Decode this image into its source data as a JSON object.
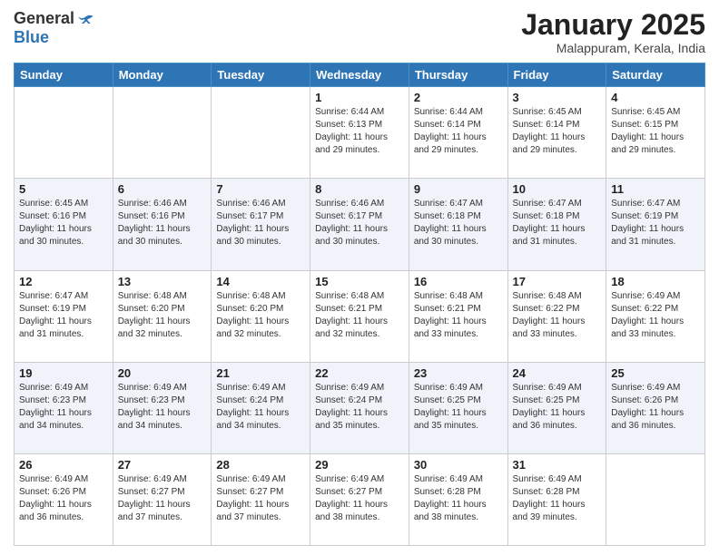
{
  "logo": {
    "general": "General",
    "blue": "Blue"
  },
  "header": {
    "month": "January 2025",
    "location": "Malappuram, Kerala, India"
  },
  "weekdays": [
    "Sunday",
    "Monday",
    "Tuesday",
    "Wednesday",
    "Thursday",
    "Friday",
    "Saturday"
  ],
  "weeks": [
    [
      {
        "day": "",
        "info": ""
      },
      {
        "day": "",
        "info": ""
      },
      {
        "day": "",
        "info": ""
      },
      {
        "day": "1",
        "info": "Sunrise: 6:44 AM\nSunset: 6:13 PM\nDaylight: 11 hours\nand 29 minutes."
      },
      {
        "day": "2",
        "info": "Sunrise: 6:44 AM\nSunset: 6:14 PM\nDaylight: 11 hours\nand 29 minutes."
      },
      {
        "day": "3",
        "info": "Sunrise: 6:45 AM\nSunset: 6:14 PM\nDaylight: 11 hours\nand 29 minutes."
      },
      {
        "day": "4",
        "info": "Sunrise: 6:45 AM\nSunset: 6:15 PM\nDaylight: 11 hours\nand 29 minutes."
      }
    ],
    [
      {
        "day": "5",
        "info": "Sunrise: 6:45 AM\nSunset: 6:16 PM\nDaylight: 11 hours\nand 30 minutes."
      },
      {
        "day": "6",
        "info": "Sunrise: 6:46 AM\nSunset: 6:16 PM\nDaylight: 11 hours\nand 30 minutes."
      },
      {
        "day": "7",
        "info": "Sunrise: 6:46 AM\nSunset: 6:17 PM\nDaylight: 11 hours\nand 30 minutes."
      },
      {
        "day": "8",
        "info": "Sunrise: 6:46 AM\nSunset: 6:17 PM\nDaylight: 11 hours\nand 30 minutes."
      },
      {
        "day": "9",
        "info": "Sunrise: 6:47 AM\nSunset: 6:18 PM\nDaylight: 11 hours\nand 30 minutes."
      },
      {
        "day": "10",
        "info": "Sunrise: 6:47 AM\nSunset: 6:18 PM\nDaylight: 11 hours\nand 31 minutes."
      },
      {
        "day": "11",
        "info": "Sunrise: 6:47 AM\nSunset: 6:19 PM\nDaylight: 11 hours\nand 31 minutes."
      }
    ],
    [
      {
        "day": "12",
        "info": "Sunrise: 6:47 AM\nSunset: 6:19 PM\nDaylight: 11 hours\nand 31 minutes."
      },
      {
        "day": "13",
        "info": "Sunrise: 6:48 AM\nSunset: 6:20 PM\nDaylight: 11 hours\nand 32 minutes."
      },
      {
        "day": "14",
        "info": "Sunrise: 6:48 AM\nSunset: 6:20 PM\nDaylight: 11 hours\nand 32 minutes."
      },
      {
        "day": "15",
        "info": "Sunrise: 6:48 AM\nSunset: 6:21 PM\nDaylight: 11 hours\nand 32 minutes."
      },
      {
        "day": "16",
        "info": "Sunrise: 6:48 AM\nSunset: 6:21 PM\nDaylight: 11 hours\nand 33 minutes."
      },
      {
        "day": "17",
        "info": "Sunrise: 6:48 AM\nSunset: 6:22 PM\nDaylight: 11 hours\nand 33 minutes."
      },
      {
        "day": "18",
        "info": "Sunrise: 6:49 AM\nSunset: 6:22 PM\nDaylight: 11 hours\nand 33 minutes."
      }
    ],
    [
      {
        "day": "19",
        "info": "Sunrise: 6:49 AM\nSunset: 6:23 PM\nDaylight: 11 hours\nand 34 minutes."
      },
      {
        "day": "20",
        "info": "Sunrise: 6:49 AM\nSunset: 6:23 PM\nDaylight: 11 hours\nand 34 minutes."
      },
      {
        "day": "21",
        "info": "Sunrise: 6:49 AM\nSunset: 6:24 PM\nDaylight: 11 hours\nand 34 minutes."
      },
      {
        "day": "22",
        "info": "Sunrise: 6:49 AM\nSunset: 6:24 PM\nDaylight: 11 hours\nand 35 minutes."
      },
      {
        "day": "23",
        "info": "Sunrise: 6:49 AM\nSunset: 6:25 PM\nDaylight: 11 hours\nand 35 minutes."
      },
      {
        "day": "24",
        "info": "Sunrise: 6:49 AM\nSunset: 6:25 PM\nDaylight: 11 hours\nand 36 minutes."
      },
      {
        "day": "25",
        "info": "Sunrise: 6:49 AM\nSunset: 6:26 PM\nDaylight: 11 hours\nand 36 minutes."
      }
    ],
    [
      {
        "day": "26",
        "info": "Sunrise: 6:49 AM\nSunset: 6:26 PM\nDaylight: 11 hours\nand 36 minutes."
      },
      {
        "day": "27",
        "info": "Sunrise: 6:49 AM\nSunset: 6:27 PM\nDaylight: 11 hours\nand 37 minutes."
      },
      {
        "day": "28",
        "info": "Sunrise: 6:49 AM\nSunset: 6:27 PM\nDaylight: 11 hours\nand 37 minutes."
      },
      {
        "day": "29",
        "info": "Sunrise: 6:49 AM\nSunset: 6:27 PM\nDaylight: 11 hours\nand 38 minutes."
      },
      {
        "day": "30",
        "info": "Sunrise: 6:49 AM\nSunset: 6:28 PM\nDaylight: 11 hours\nand 38 minutes."
      },
      {
        "day": "31",
        "info": "Sunrise: 6:49 AM\nSunset: 6:28 PM\nDaylight: 11 hours\nand 39 minutes."
      },
      {
        "day": "",
        "info": ""
      }
    ]
  ]
}
